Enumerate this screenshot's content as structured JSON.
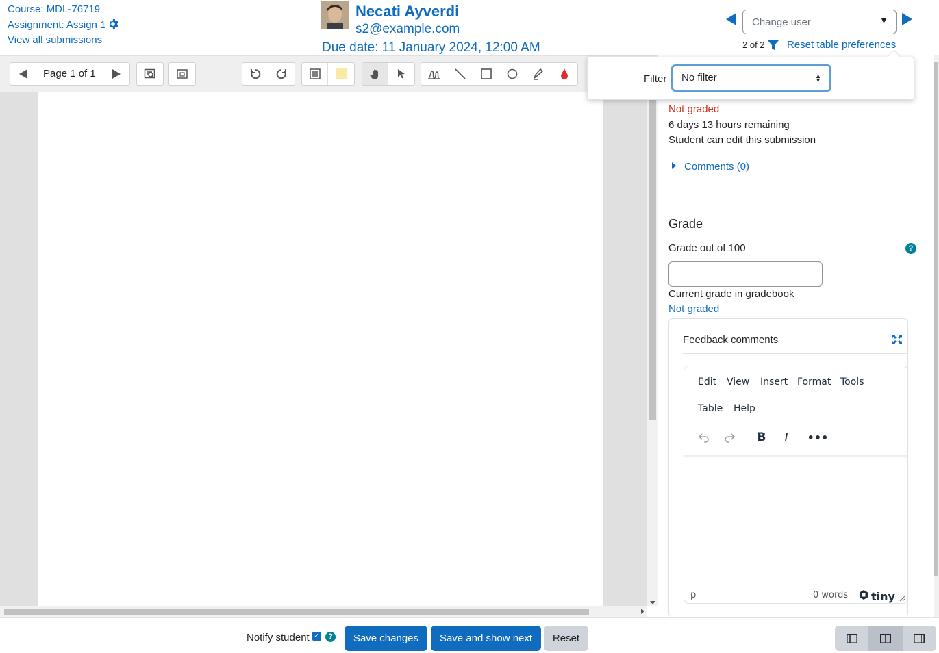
{
  "header": {
    "course_link": "Course: MDL-76719",
    "assignment_link": "Assignment: Assign 1",
    "view_all_link": "View all submissions",
    "user_name": "Necati Ayverdi",
    "user_email": "s2@example.com",
    "due_date": "Due date: 11 January 2024, 12:00 AM",
    "change_user_placeholder": "Change user",
    "user_count": "2 of 2",
    "reset_prefs": "Reset table preferences"
  },
  "toolbar": {
    "page_label": "Page 1 of 1"
  },
  "filter": {
    "label": "Filter",
    "selected": "No filter"
  },
  "grade_panel": {
    "status": "Not graded",
    "time_remaining": "6 days 13 hours remaining",
    "can_edit": "Student can edit this submission",
    "comments_link": "Comments (0)",
    "grade_heading": "Grade",
    "grade_label": "Grade out of 100",
    "grade_value": "",
    "current_grade_label": "Current grade in gradebook",
    "current_grade_value": "Not graded",
    "feedback_title": "Feedback comments",
    "editor": {
      "menu": [
        "Edit",
        "View",
        "Insert",
        "Format",
        "Tools",
        "Table",
        "Help"
      ],
      "status_path": "p",
      "word_count": "0 words",
      "brand": "tiny"
    }
  },
  "footer": {
    "notify_label": "Notify student",
    "notify_checked": true,
    "save_changes": "Save changes",
    "save_next": "Save and show next",
    "reset": "Reset"
  },
  "colors": {
    "primary": "#0f6cbf",
    "danger": "#ca3120",
    "info": "#008196"
  }
}
